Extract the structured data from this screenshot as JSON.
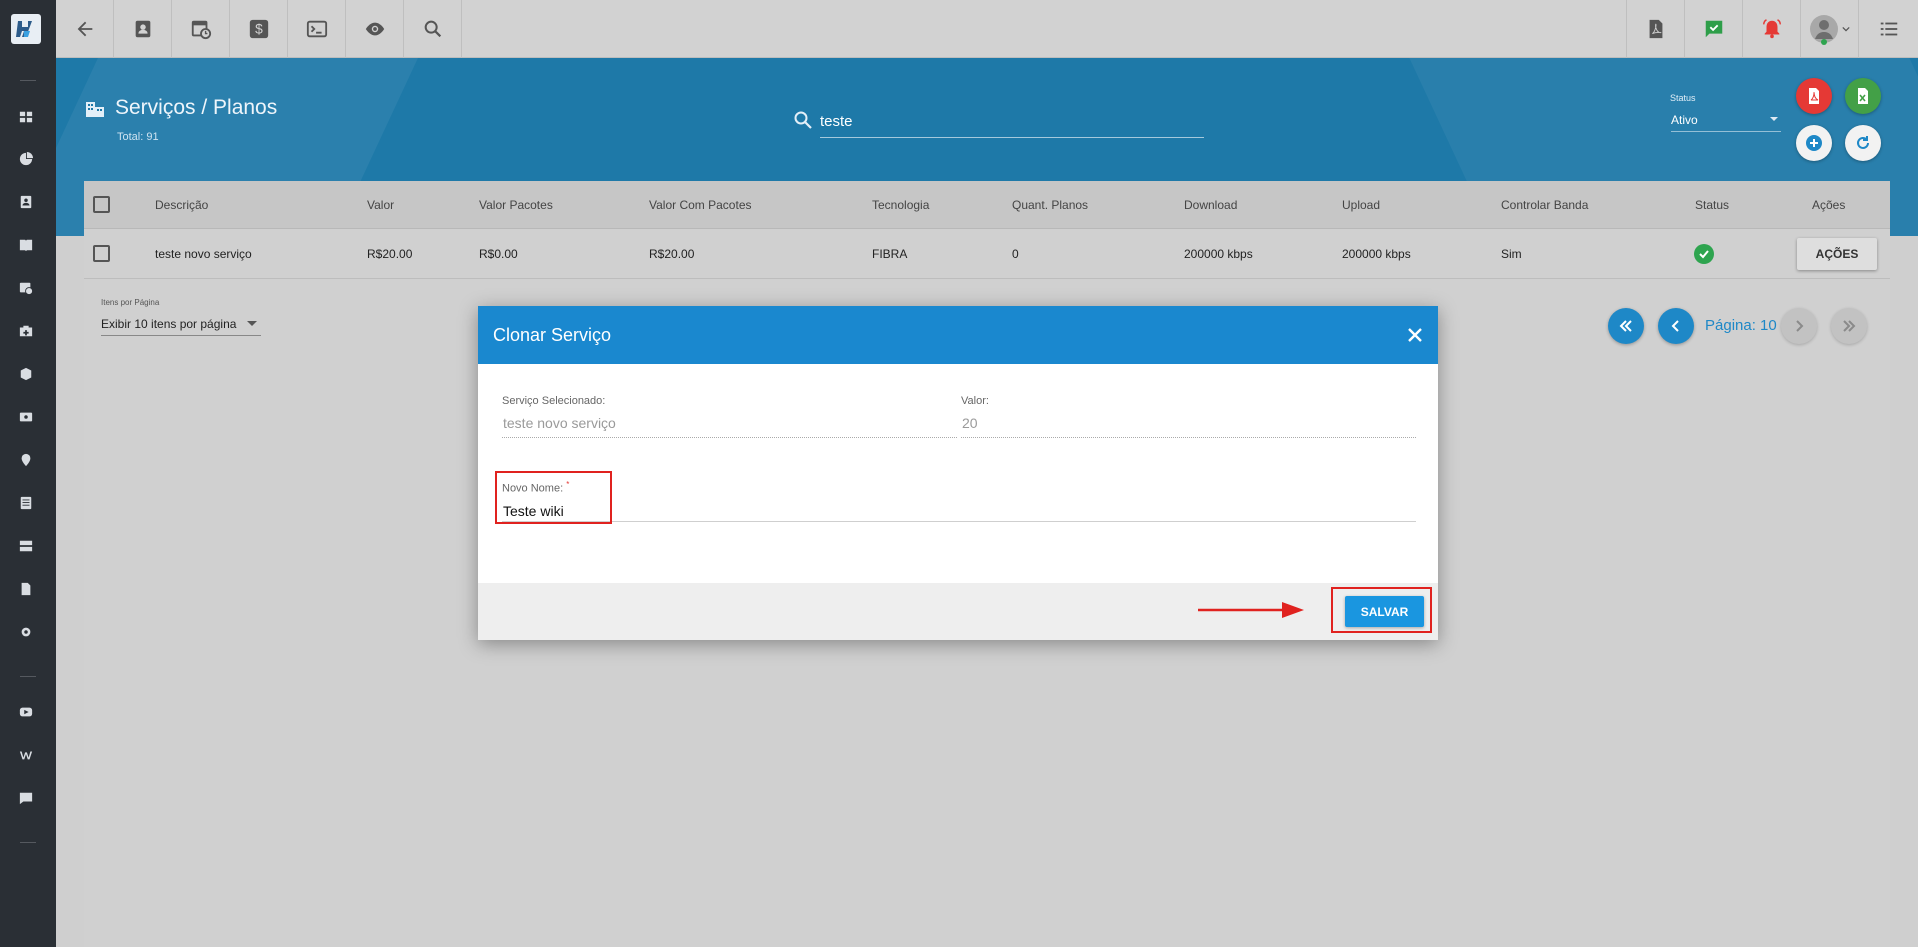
{
  "sidebar": {
    "icons": [
      "dashboard-icon",
      "pie-chart-icon",
      "contact-card-icon",
      "book-icon",
      "calendar-clock-icon",
      "medical-bag-icon",
      "package-icon",
      "money-icon",
      "map-pin-icon",
      "document-list-icon",
      "server-icon",
      "file-icon",
      "gear-icon",
      "youtube-icon",
      "wiki-icon",
      "chat-icon"
    ]
  },
  "topbar": {
    "left_icons": [
      "back-arrow-icon",
      "contact-icon",
      "calendar-clock-icon",
      "dollar-icon",
      "terminal-icon",
      "eye-icon",
      "search-icon"
    ],
    "right_icons": [
      "pdf-document-icon",
      "chat-check-icon",
      "alarm-bell-icon",
      "user-avatar",
      "menu-list-icon"
    ]
  },
  "header": {
    "title": "Serviços / Planos",
    "total": "Total: 91",
    "search_value": "teste",
    "status_label": "Status",
    "status_value": "Ativo"
  },
  "table": {
    "columns": [
      "Descrição",
      "Valor",
      "Valor Pacotes",
      "Valor Com Pacotes",
      "Tecnologia",
      "Quant. Planos",
      "Download",
      "Upload",
      "Controlar Banda",
      "Status",
      "Ações"
    ],
    "rows": [
      {
        "descricao": "teste novo serviço",
        "valor": "R$20.00",
        "valor_pacotes": "R$0.00",
        "valor_com_pacotes": "R$20.00",
        "tecnologia": "FIBRA",
        "quant_planos": "0",
        "download": "200000 kbps",
        "upload": "200000 kbps",
        "controlar_banda": "Sim",
        "status": "ativo",
        "acoes_label": "AÇÕES"
      }
    ],
    "per_page_label": "Itens por Página",
    "per_page_value": "Exibir 10 itens por página",
    "page_label": "Página: 10"
  },
  "modal": {
    "title": "Clonar Serviço",
    "selected_label": "Serviço Selecionado:",
    "selected_value": "teste novo serviço",
    "valor_label": "Valor:",
    "valor_value": "20",
    "new_name_label": "Novo Nome:",
    "required_mark": "*",
    "new_name_value": "Teste wiki",
    "save_label": "SALVAR"
  },
  "colors": {
    "accent": "#1a88cf",
    "banner": "#1e79a8",
    "highlight": "#e0221f",
    "success": "#2ea44f"
  }
}
